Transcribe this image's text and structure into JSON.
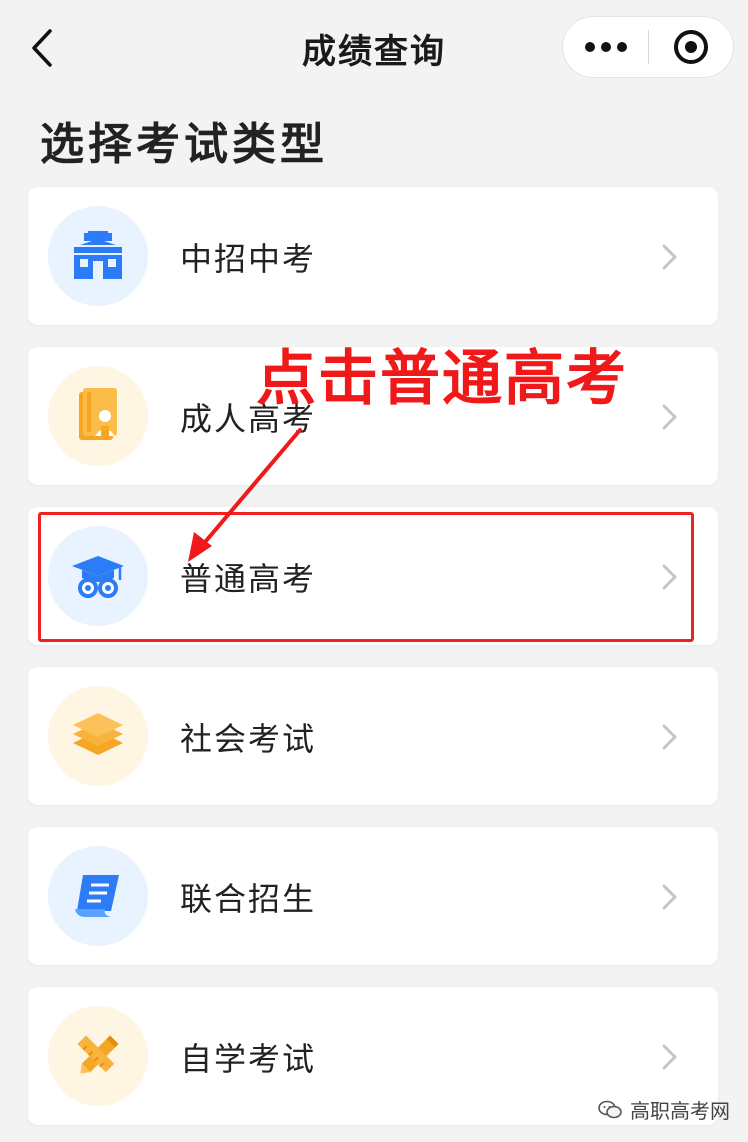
{
  "nav": {
    "title": "成绩查询",
    "back_icon": "chevron-left-icon",
    "more_icon": "more-dots-icon",
    "close_icon": "target-circle-icon"
  },
  "heading": "选择考试类型",
  "items": [
    {
      "label": "中招中考",
      "icon": "school-building-icon",
      "accent": "#2b7cf6"
    },
    {
      "label": "成人高考",
      "icon": "book-person-icon",
      "accent": "#f5a623"
    },
    {
      "label": "普通高考",
      "icon": "graduation-cap-icon",
      "accent": "#2b7cf6"
    },
    {
      "label": "社会考试",
      "icon": "layers-icon",
      "accent": "#f5a623"
    },
    {
      "label": "联合招生",
      "icon": "scroll-document-icon",
      "accent": "#2b7cf6"
    },
    {
      "label": "自学考试",
      "icon": "crossed-pencils-icon",
      "accent": "#f5a623"
    }
  ],
  "annotation": {
    "text": "点击普通高考",
    "color": "#f01818"
  },
  "watermark": {
    "text": "高职高考网",
    "icon": "wechat-icon"
  }
}
